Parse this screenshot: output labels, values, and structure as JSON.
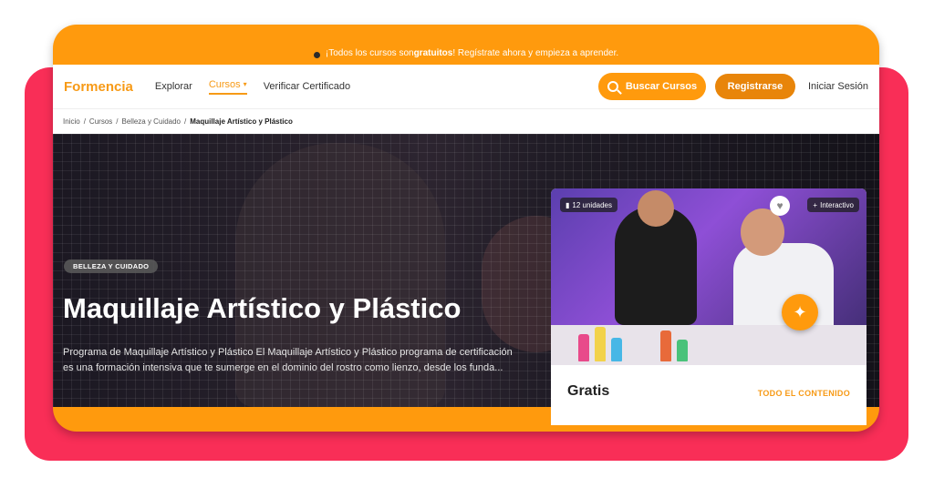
{
  "promo": {
    "prefix": "¡Todos los cursos son ",
    "bold": "gratuitos",
    "suffix": "! Regístrate ahora y empieza a aprender."
  },
  "nav": {
    "logo": "Formencia",
    "explore": "Explorar",
    "courses": "Cursos",
    "verify": "Verificar Certificado",
    "search_button": "Buscar Cursos",
    "register_button": "Registrarse",
    "login": "Iniciar Sesión"
  },
  "breadcrumb": {
    "items": [
      "Inicio",
      "Cursos",
      "Belleza y Cuidado"
    ],
    "current": "Maquillaje Artístico y Plástico",
    "separator": "/"
  },
  "hero": {
    "badge": "BELLEZA Y CUIDADO",
    "title": "Maquillaje Artístico y Plástico",
    "description": "Programa de Maquillaje Artístico y Plástico El Maquillaje Artístico y Plástico programa de certificación es una formación intensiva que te sumerge en el dominio del rostro como lienzo, desde los funda..."
  },
  "card": {
    "units": "12 unidades",
    "interactive": "Interactivo",
    "price": "Gratis",
    "content_link": "TODO EL CONTENIDO"
  },
  "colors": {
    "accent": "#ff9a0d",
    "frame": "#f92e57"
  },
  "icons": {
    "search": "search-icon",
    "heart": "heart-icon",
    "sparkle": "sparkle-icon",
    "chevron": "chevron-down-icon"
  }
}
